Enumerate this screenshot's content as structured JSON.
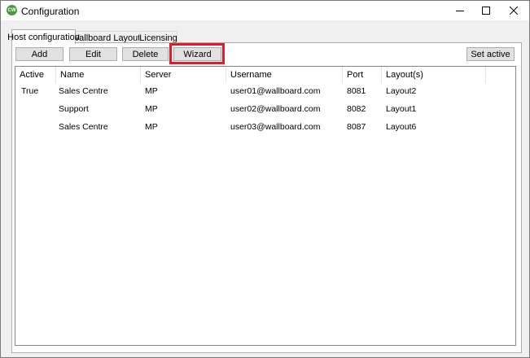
{
  "window": {
    "title": "Configuration",
    "app_icon_text": "CW",
    "icons": {
      "minimize": "minimize-icon",
      "maximize": "maximize-icon",
      "close": "close-icon"
    }
  },
  "tabs": [
    {
      "label": "Host configuration",
      "active": true
    },
    {
      "label": "Wallboard Layouts",
      "active": false
    },
    {
      "label": "Licensing",
      "active": false
    }
  ],
  "toolbar": {
    "add_label": "Add",
    "edit_label": "Edit",
    "delete_label": "Delete",
    "wizard_label": "Wizard",
    "set_active_label": "Set active"
  },
  "highlight_color": "#e41b24",
  "table": {
    "columns": [
      "Active",
      "Name",
      "Server",
      "Username",
      "Port",
      "Layout(s)"
    ],
    "rows": [
      [
        "True",
        "Sales Centre",
        "MP",
        "user01@wallboard.com",
        "8081",
        "Layout2"
      ],
      [
        "",
        "Support",
        "MP",
        "user02@wallboard.com",
        "8082",
        "Layout1"
      ],
      [
        "",
        "Sales Centre",
        "MP",
        "user03@wallboard.com",
        "8087",
        "Layout6"
      ]
    ]
  }
}
